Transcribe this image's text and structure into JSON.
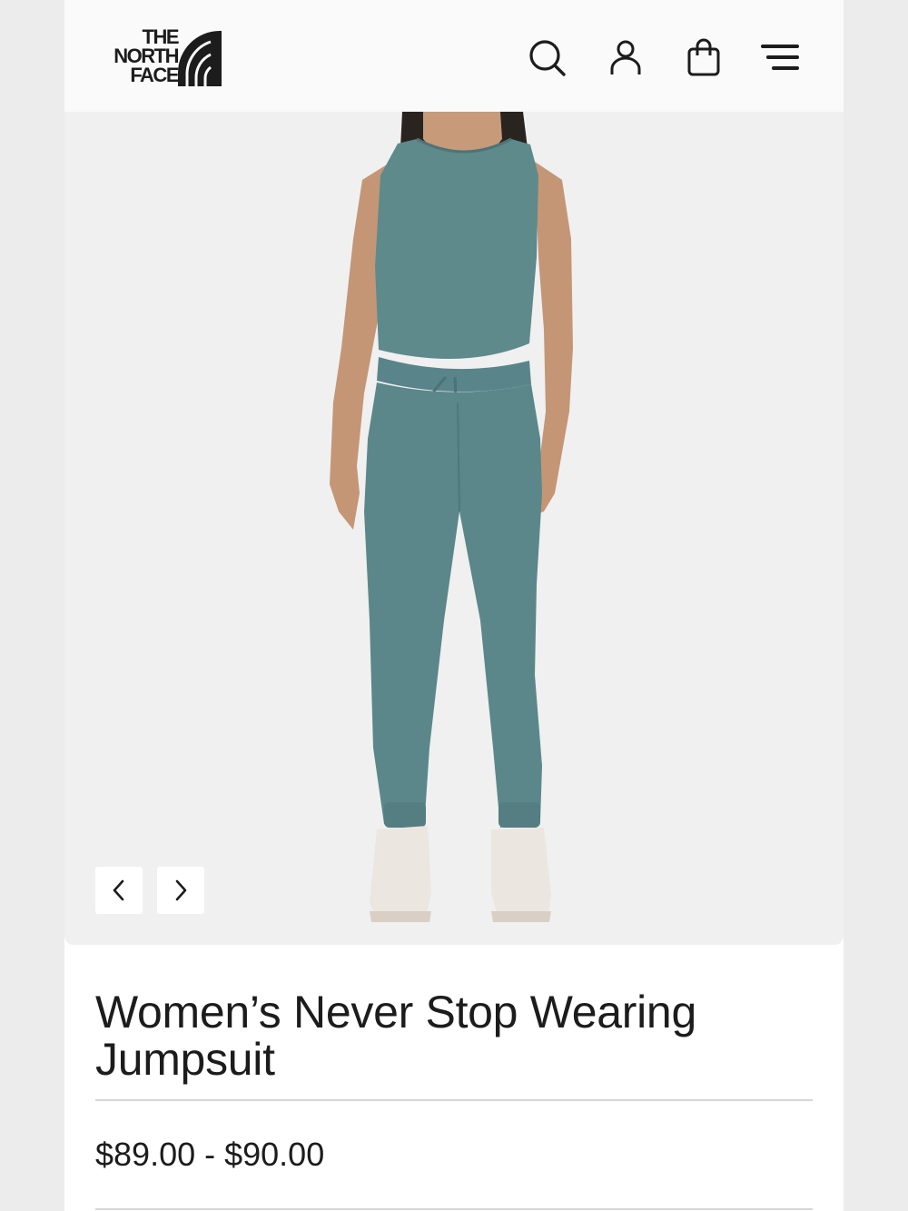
{
  "brand": {
    "logo_lines": [
      "THE",
      "NORTH",
      "FACE"
    ]
  },
  "header": {
    "icons": [
      "search-icon",
      "account-icon",
      "shopping-bag-icon",
      "menu-icon"
    ]
  },
  "gallery": {
    "prev_icon": "chevron-left-icon",
    "next_icon": "chevron-right-icon"
  },
  "product": {
    "title": "Women’s Never Stop Wearing Jumpsuit",
    "price": "$89.00 - $90.00"
  },
  "colors": {
    "page_bg": "#ececec",
    "header_bg": "#fafafa",
    "image_bg": "#f0f0f0",
    "garment": "#5e8a8c",
    "text": "#1c1c1c"
  }
}
